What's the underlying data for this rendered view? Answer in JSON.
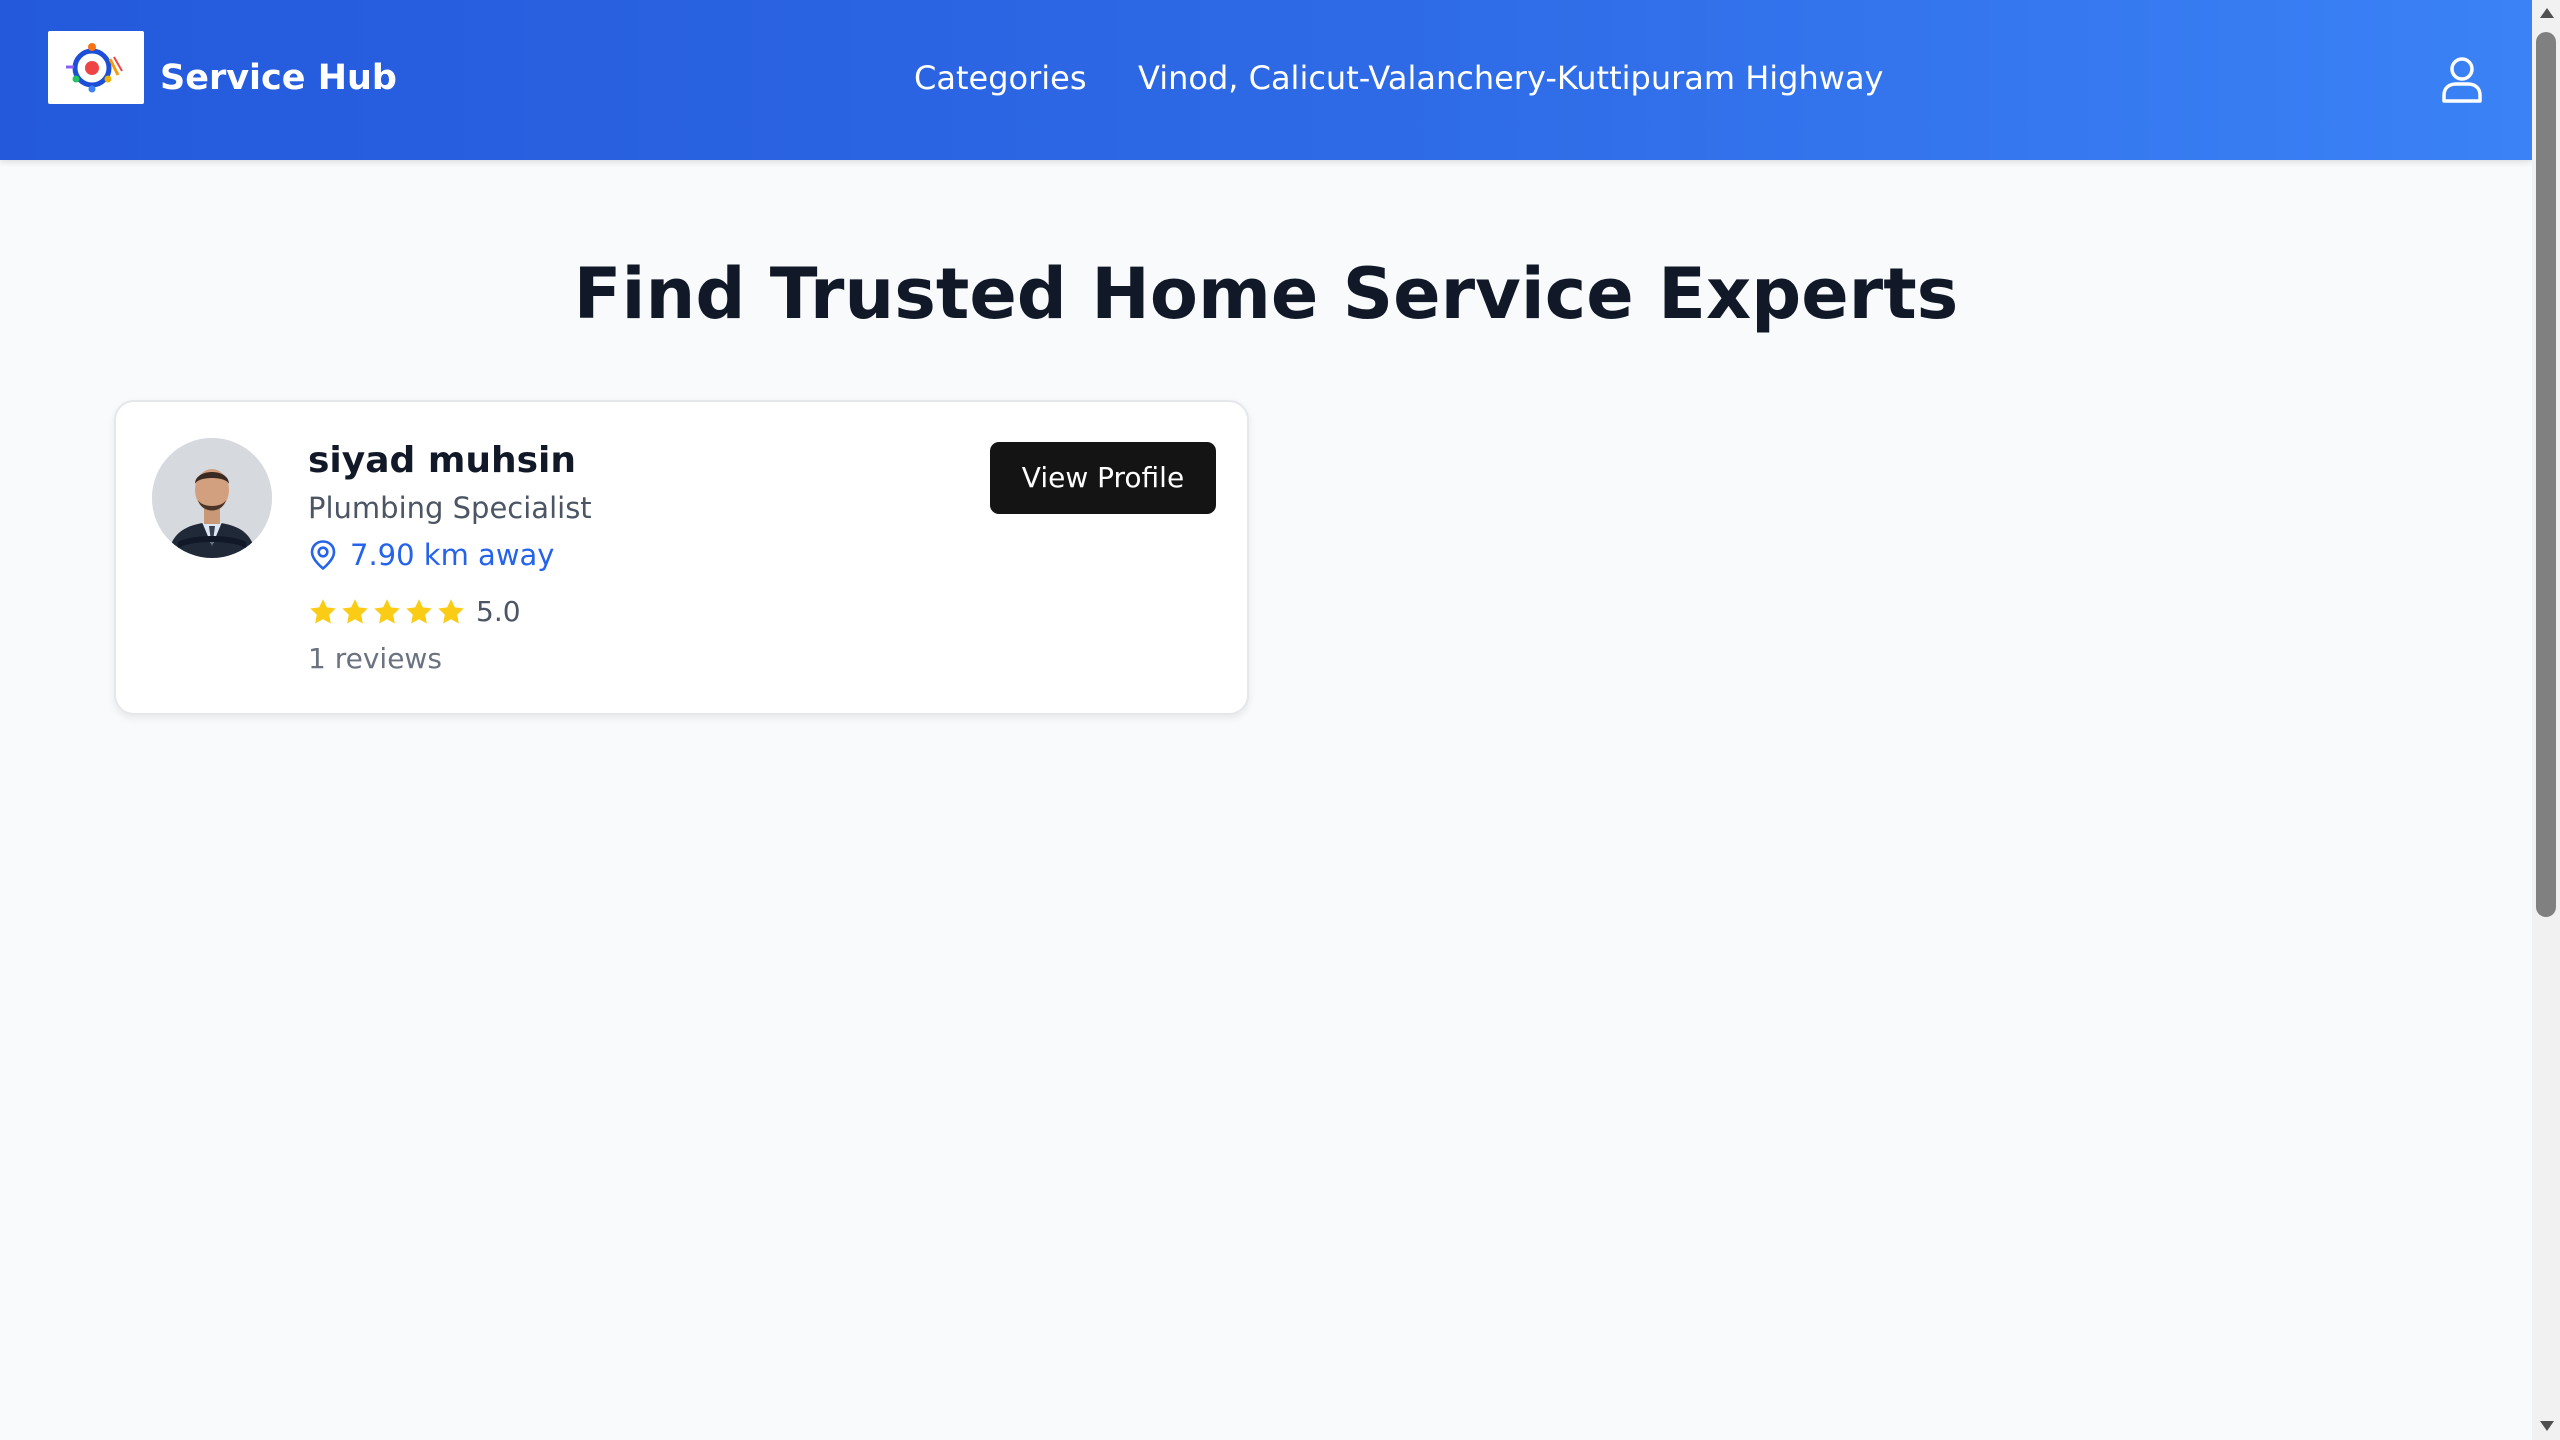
{
  "header": {
    "brand": "Service Hub",
    "nav": {
      "categories": "Categories",
      "location": "Vinod, Calicut-Valanchery-Kuttipuram Highway"
    },
    "icons": {
      "logo": "service-hub-logo",
      "user": "user-icon"
    },
    "gradient": [
      "#2459dc",
      "#3b82f6"
    ]
  },
  "main": {
    "title": "Find Trusted Home Service Experts"
  },
  "providers": [
    {
      "name": "siyad muhsin",
      "specialty": "Plumbing Specialist",
      "distance": "7.90 km away",
      "stars": 5,
      "rating": "5.0",
      "reviews": "1 reviews",
      "button": "View Profile",
      "icons": {
        "distance": "location-pin-icon",
        "rating": "star-icon"
      }
    }
  ],
  "colors": {
    "accent": "#2563eb",
    "star": "#facc15",
    "button": "#141414",
    "background": "#f8fafc"
  }
}
